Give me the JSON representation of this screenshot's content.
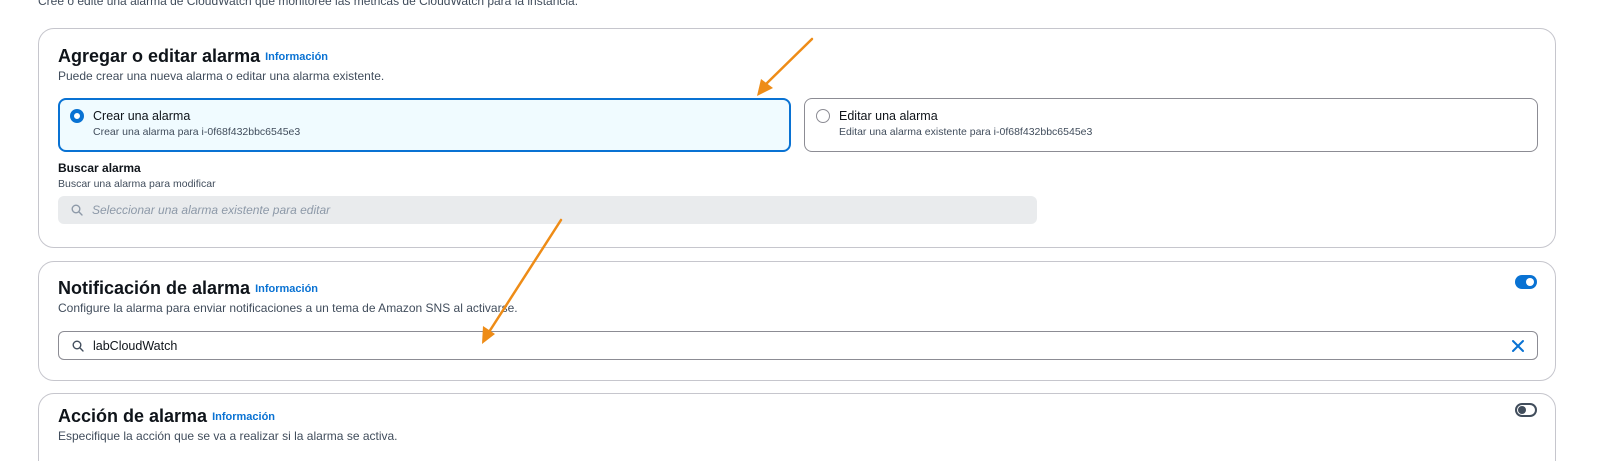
{
  "page": {
    "intro": "Cree o edite una alarma de CloudWatch que monitoree las métricas de CloudWatch para la instancia."
  },
  "add_edit": {
    "title": "Agregar o editar alarma",
    "info": "Información",
    "description": "Puede crear una nueva alarma o editar una alarma existente.",
    "options": [
      {
        "label": "Crear una alarma",
        "description": "Crear una alarma para i-0f68f432bbc6545e3",
        "selected": true
      },
      {
        "label": "Editar una alarma",
        "description": "Editar una alarma existente para i-0f68f432bbc6545e3",
        "selected": false
      }
    ],
    "search_label": "Buscar alarma",
    "search_description": "Buscar una alarma para modificar",
    "search_placeholder": "Seleccionar una alarma existente para editar"
  },
  "notification": {
    "title": "Notificación de alarma",
    "info": "Información",
    "description": "Configure la alarma para enviar notificaciones a un tema de Amazon SNS al activarse.",
    "enabled": true,
    "topic_value": "labCloudWatch"
  },
  "action": {
    "title": "Acción de alarma",
    "info": "Información",
    "description": "Especifique la acción que se va a realizar si la alarma se activa.",
    "enabled": false
  },
  "annotations": {
    "arrow_color": "#ee8c17"
  },
  "colors": {
    "accent": "#0972d3",
    "selected_tile_bg": "#f0fbff",
    "border": "#c6c6cd"
  }
}
